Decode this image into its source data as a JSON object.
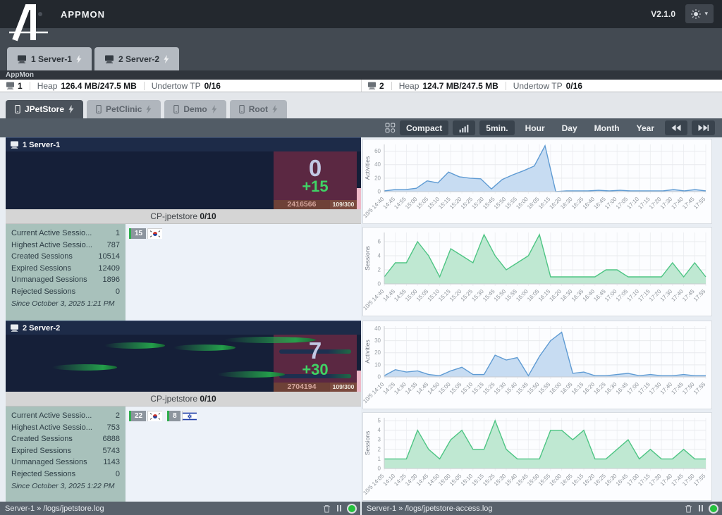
{
  "header": {
    "title": "APPMON",
    "version": "V2.1.0"
  },
  "server_tabs": [
    {
      "label": "1 Server-1"
    },
    {
      "label": "2 Server-2"
    }
  ],
  "appmon_label": "AppMon",
  "server_status": [
    {
      "num": "1",
      "heap_label": "Heap",
      "heap_value": "126.4 MB/247.5 MB",
      "tp_label": "Undertow TP",
      "tp_value": "0/16"
    },
    {
      "num": "2",
      "heap_label": "Heap",
      "heap_value": "124.7 MB/247.5 MB",
      "tp_label": "Undertow TP",
      "tp_value": "0/16"
    }
  ],
  "app_tabs": [
    {
      "label": "JPetStore"
    },
    {
      "label": "PetClinic"
    },
    {
      "label": "Demo"
    },
    {
      "label": "Root"
    }
  ],
  "toolbar": {
    "compact": "Compact",
    "ranges": [
      "5min.",
      "Hour",
      "Day",
      "Month",
      "Year"
    ]
  },
  "servers": [
    {
      "name": "1 Server-1",
      "active": "0",
      "delta": "+15",
      "total": "2416566",
      "capacity": "109/300",
      "cp_label": "CP-jpetstore",
      "cp_value": "0/10",
      "stats": [
        {
          "label": "Current Active Sessio...",
          "value": "1"
        },
        {
          "label": "Highest Active Sessio...",
          "value": "787"
        },
        {
          "label": "Created Sessions",
          "value": "10514"
        },
        {
          "label": "Expired Sessions",
          "value": "12409"
        },
        {
          "label": "Unmanaged Sessions",
          "value": "1896"
        },
        {
          "label": "Rejected Sessions",
          "value": "0"
        }
      ],
      "since": "Since October 3, 2025 1:21 PM",
      "badges": [
        {
          "count": "15",
          "flag": "south-korea"
        }
      ]
    },
    {
      "name": "2 Server-2",
      "active": "7",
      "delta": "+30",
      "total": "2704194",
      "capacity": "109/300",
      "cp_label": "CP-jpetstore",
      "cp_value": "0/10",
      "stats": [
        {
          "label": "Current Active Sessio...",
          "value": "2"
        },
        {
          "label": "Highest Active Sessio...",
          "value": "753"
        },
        {
          "label": "Created Sessions",
          "value": "6888"
        },
        {
          "label": "Expired Sessions",
          "value": "5743"
        },
        {
          "label": "Unmanaged Sessions",
          "value": "1143"
        },
        {
          "label": "Rejected Sessions",
          "value": "0"
        }
      ],
      "since": "Since October 3, 2025 1:22 PM",
      "badges": [
        {
          "count": "22",
          "flag": "south-korea"
        },
        {
          "count": "8",
          "flag": "israel"
        }
      ]
    }
  ],
  "footer": {
    "logs": [
      {
        "path": "Server-1 » /logs/jpetstore.log"
      },
      {
        "path": "Server-1 » /logs/jpetstore-access.log"
      }
    ]
  },
  "colors": {
    "accent_green": "#3fd465",
    "panel_maroon": "#5b2842",
    "chart_blue": "#5f9bd3",
    "chart_green": "#4ec584"
  },
  "chart_data": [
    {
      "type": "area",
      "title": "Server-1 Activities",
      "ylabel": "Activities",
      "xlabel": "",
      "line": "#5f9bd3",
      "fill": "#c7dcf2",
      "ymax": 70,
      "yticks": [
        0,
        20,
        40,
        60
      ],
      "grid": true,
      "legend": "none",
      "labels": [
        "10/5 14:40",
        "14:45",
        "14:55",
        "15:00",
        "15:05",
        "15:10",
        "15:15",
        "15:20",
        "15:25",
        "15:30",
        "15:45",
        "15:50",
        "15:55",
        "16:00",
        "16:05",
        "16:15",
        "16:20",
        "16:30",
        "16:35",
        "16:40",
        "16:45",
        "17:00",
        "17:05",
        "17:10",
        "17:15",
        "17:20",
        "17:30",
        "17:40",
        "17:45",
        "17:55"
      ],
      "values": [
        1,
        3,
        3,
        5,
        16,
        13,
        29,
        22,
        20,
        19,
        4,
        18,
        25,
        31,
        38,
        68,
        0,
        1,
        1,
        1,
        2,
        1,
        2,
        1,
        1,
        1,
        1,
        3,
        1,
        3,
        1
      ]
    },
    {
      "type": "area",
      "title": "Server-1 Sessions",
      "ylabel": "Sessions",
      "xlabel": "",
      "line": "#4ec584",
      "fill": "#bfe8d2",
      "ymax": 7.3,
      "yticks": [
        0,
        2,
        4,
        6
      ],
      "grid": true,
      "legend": "none",
      "labels": [
        "10/5 14:40",
        "14:45",
        "14:55",
        "15:00",
        "15:05",
        "15:10",
        "15:15",
        "15:20",
        "15:25",
        "15:30",
        "15:45",
        "15:50",
        "15:55",
        "16:00",
        "16:05",
        "16:15",
        "16:20",
        "16:30",
        "16:35",
        "16:40",
        "16:45",
        "17:00",
        "17:05",
        "17:10",
        "17:15",
        "17:20",
        "17:30",
        "17:40",
        "17:45",
        "17:55"
      ],
      "values": [
        1,
        3,
        3,
        6,
        4,
        1,
        5,
        4,
        3,
        7,
        4,
        2,
        3,
        4,
        7,
        1,
        1,
        1,
        1,
        1,
        2,
        2,
        1,
        1,
        1,
        1,
        3,
        1,
        3,
        1
      ]
    },
    {
      "type": "area",
      "title": "Server-2 Activities",
      "ylabel": "Activities",
      "xlabel": "",
      "line": "#5f9bd3",
      "fill": "#c7dcf2",
      "ymax": 42,
      "yticks": [
        0,
        10,
        20,
        30,
        40
      ],
      "grid": true,
      "legend": "none",
      "labels": [
        "10/5 14:10",
        "14:25",
        "14:30",
        "14:35",
        "14:45",
        "14:50",
        "15:00",
        "15:05",
        "15:10",
        "15:15",
        "15:25",
        "15:30",
        "15:40",
        "15:45",
        "15:50",
        "15:55",
        "16:00",
        "16:05",
        "16:15",
        "16:20",
        "16:25",
        "16:30",
        "16:45",
        "17:00",
        "17:15",
        "17:30",
        "17:40",
        "17:45",
        "17:50",
        "17:55"
      ],
      "values": [
        1,
        6,
        4,
        5,
        2,
        1,
        5,
        8,
        2,
        2,
        18,
        14,
        16,
        1,
        17,
        30,
        37,
        3,
        4,
        1,
        1,
        2,
        3,
        1,
        2,
        1,
        1,
        2,
        1,
        1
      ]
    },
    {
      "type": "area",
      "title": "Server-2 Sessions",
      "ylabel": "Sessions",
      "xlabel": "",
      "line": "#4ec584",
      "fill": "#bfe8d2",
      "ymax": 5.3,
      "yticks": [
        0,
        1,
        2,
        3,
        4,
        5
      ],
      "grid": true,
      "legend": "none",
      "labels": [
        "10/5 14:05",
        "14:10",
        "14:25",
        "14:30",
        "14:45",
        "14:50",
        "15:00",
        "15:05",
        "15:10",
        "15:15",
        "15:25",
        "15:30",
        "15:40",
        "15:45",
        "15:50",
        "15:55",
        "16:00",
        "16:05",
        "16:15",
        "16:20",
        "16:25",
        "16:30",
        "16:45",
        "17:00",
        "17:15",
        "17:30",
        "17:40",
        "17:45",
        "17:50",
        "17:55"
      ],
      "values": [
        1,
        1,
        1,
        4,
        2,
        1,
        3,
        4,
        2,
        2,
        5,
        2,
        1,
        1,
        1,
        4,
        4,
        3,
        4,
        1,
        1,
        2,
        3,
        1,
        2,
        1,
        1,
        2,
        1,
        1
      ]
    }
  ]
}
